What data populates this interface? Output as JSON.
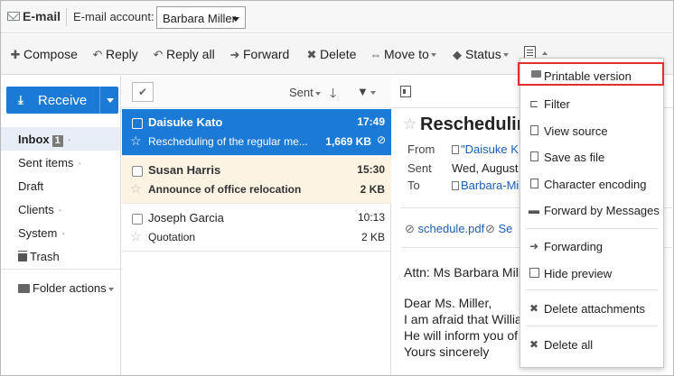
{
  "header": {
    "app_title": "E-mail",
    "account_label": "E-mail account:",
    "account_value": "Barbara Miller"
  },
  "toolbar": {
    "compose": "Compose",
    "reply": "Reply",
    "reply_all": "Reply all",
    "forward": "Forward",
    "delete": "Delete",
    "move_to": "Move to",
    "status": "Status"
  },
  "sidebar": {
    "receive": "Receive",
    "folders": [
      {
        "label": "Inbox",
        "badge": "1"
      },
      {
        "label": "Sent items"
      },
      {
        "label": "Draft"
      },
      {
        "label": "Clients"
      },
      {
        "label": "System"
      },
      {
        "label": "Trash"
      }
    ],
    "folder_actions": "Folder actions"
  },
  "message_list": {
    "sort_label": "Sent",
    "rows": [
      {
        "from": "Daisuke Kato",
        "time": "17:49",
        "subject": "Rescheduling of the regular me...",
        "size": "1,669 KB"
      },
      {
        "from": "Susan Harris",
        "time": "15:30",
        "subject": "Announce of office relocation",
        "size": "2 KB"
      },
      {
        "from": "Joseph Garcia",
        "time": "10:13",
        "subject": "Quotation",
        "size": "2 KB"
      }
    ]
  },
  "preview": {
    "subject": "Reschedulin",
    "from_label": "From",
    "from_value": "\"Daisuke K",
    "sent_label": "Sent",
    "sent_value": "Wed, August (",
    "to_label": "To",
    "to_value": "Barbara-Mi",
    "attachment_1": "schedule.pdf",
    "attachment_2": "Se",
    "body": [
      "Attn: Ms Barbara Mille",
      "Dear Ms. Miller,",
      "I am afraid that Willian",
      "He will inform you of t",
      "Yours sincerely"
    ]
  },
  "menu": {
    "items": [
      "Printable version",
      "Filter",
      "View source",
      "Save as file",
      "Character encoding",
      "Forward by Messages",
      "Forwarding",
      "Hide preview",
      "Delete attachments",
      "Delete all"
    ]
  },
  "colors": {
    "accent": "#1a7ad6",
    "highlight_border": "#e22e2e",
    "unread_row": "#fcf3e3",
    "link": "#1a5fb4"
  }
}
